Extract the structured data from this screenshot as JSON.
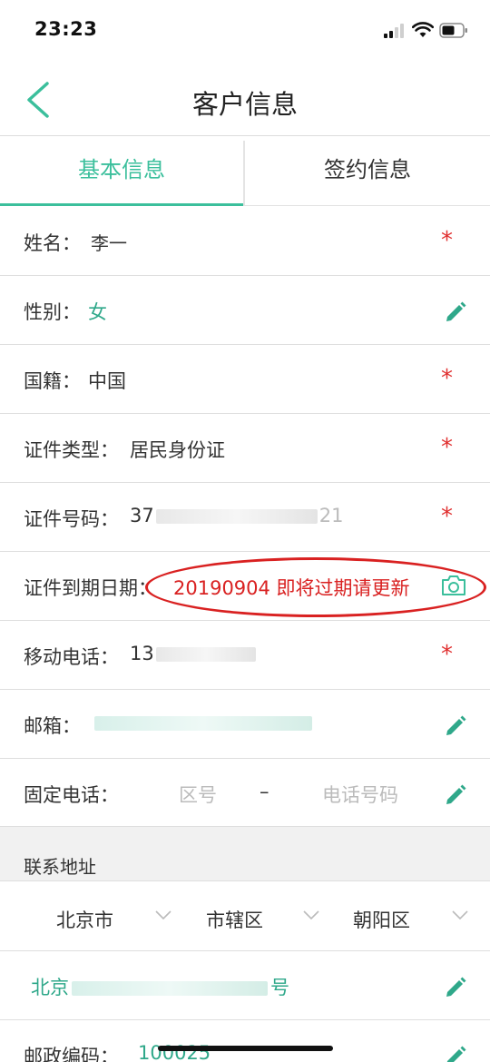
{
  "status_bar": {
    "time": "23:23"
  },
  "nav": {
    "title": "客户信息",
    "back_icon": "chevron-left-icon"
  },
  "tabs": [
    {
      "label": "基本信息",
      "active": true
    },
    {
      "label": "签约信息",
      "active": false
    }
  ],
  "fields": {
    "name": {
      "label": "姓名：",
      "value": "李一",
      "required": true
    },
    "gender": {
      "label": "性别：",
      "value": "女",
      "editable": true
    },
    "nationality": {
      "label": "国籍：",
      "value": "中国",
      "required": true
    },
    "id_type": {
      "label": "证件类型：",
      "value": "居民身份证",
      "required": true
    },
    "id_number": {
      "label": "证件号码：",
      "value_prefix": "37",
      "value_suffix": "21",
      "required": true
    },
    "id_expiry": {
      "label": "证件到期日期：",
      "value": "20190904  即将过期请更新",
      "icon": "camera-icon",
      "alert_color": "#d92121"
    },
    "mobile": {
      "label": "移动电话：",
      "value_prefix": "13",
      "required": true
    },
    "email": {
      "label": "邮箱：",
      "editable": true
    },
    "landline": {
      "label": "固定电话：",
      "area_placeholder": "区号",
      "separator": "–",
      "number_placeholder": "电话号码",
      "editable": true
    }
  },
  "address": {
    "section_title": "联系地址",
    "province": "北京市",
    "city": "市辖区",
    "district": "朝阳区",
    "detail_prefix": "北京",
    "detail_suffix": "号"
  },
  "postcode": {
    "label": "邮政编码：",
    "value": "100025"
  },
  "required_mark": "*",
  "colors": {
    "accent": "#3bbf9c",
    "required": "#e03030",
    "value_teal": "#2fa88a"
  }
}
